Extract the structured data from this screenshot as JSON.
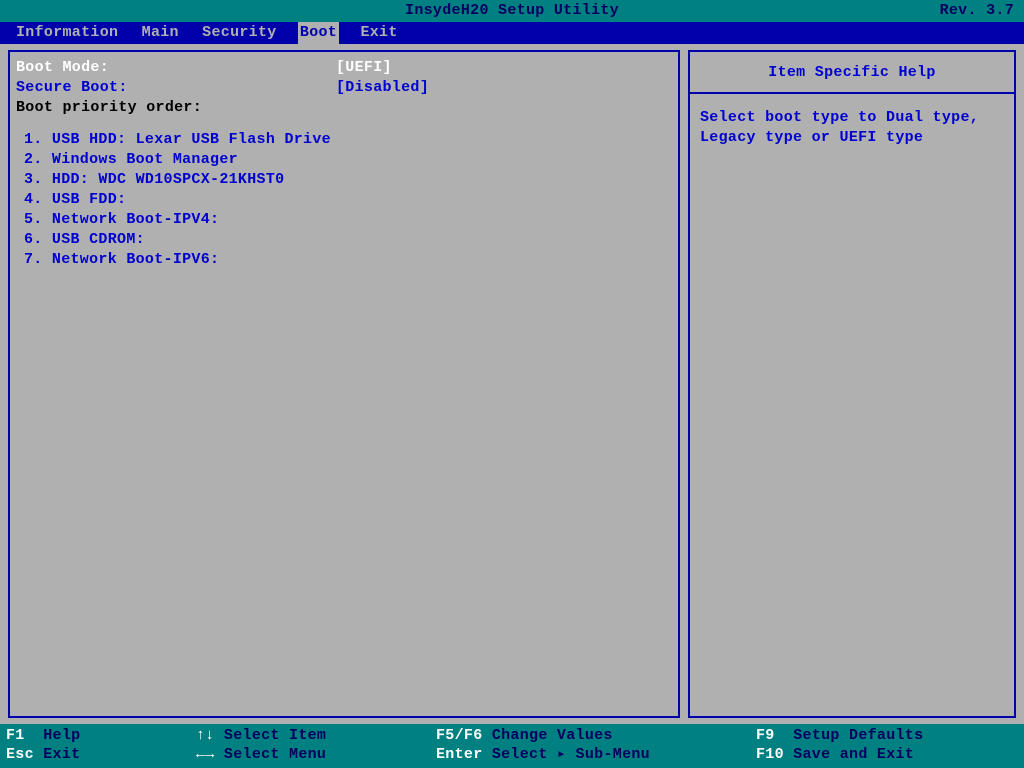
{
  "header": {
    "title": "InsydeH20 Setup Utility",
    "revision": "Rev. 3.7"
  },
  "menu": {
    "items": [
      "Information",
      "Main",
      "Security",
      "Boot",
      "Exit"
    ],
    "active_index": 3
  },
  "settings": {
    "boot_mode": {
      "label": "Boot Mode:",
      "value": "[UEFI]"
    },
    "secure_boot": {
      "label": "Secure Boot:",
      "value": "[Disabled]"
    },
    "priority_label": "Boot priority order:"
  },
  "boot_order": [
    "1. USB HDD: Lexar  USB Flash Drive",
    "2. Windows Boot Manager",
    "3. HDD: WDC WD10SPCX-21KHST0",
    "4. USB FDD:",
    "5. Network Boot-IPV4:",
    "6. USB CDROM:",
    "7. Network Boot-IPV6:"
  ],
  "help": {
    "title": "Item Specific Help",
    "body": "Select boot type to Dual type, Legacy type or UEFI type"
  },
  "footer": {
    "r1c1_key": "F1",
    "r1c1_txt": "  Help",
    "r1c2_key": "↑↓",
    "r1c2_txt": " Select Item",
    "r1c3_key": "F5/F6",
    "r1c3_txt": " Change Values",
    "r1c4_key": "F9",
    "r1c4_txt": "  Setup Defaults",
    "r2c1_key": "Esc",
    "r2c1_txt": " Exit",
    "r2c2_key": "←→",
    "r2c2_txt": " Select Menu",
    "r2c3_key": "Enter",
    "r2c3_txt": " Select ▸ Sub-Menu",
    "r2c4_key": "F10",
    "r2c4_txt": " Save and Exit"
  }
}
